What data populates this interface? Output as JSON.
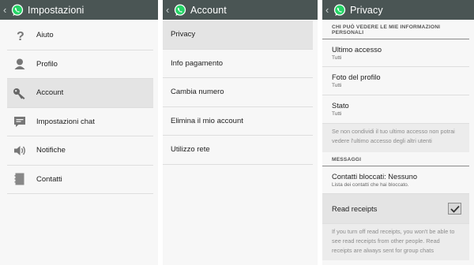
{
  "colors": {
    "appbar": "#4a5554",
    "whatsapp_green": "#25d366",
    "selected_row": "#e4e4e4",
    "divider": "#dedede"
  },
  "panel1": {
    "title": "Impostazioni",
    "items": [
      {
        "label": "Aiuto",
        "icon": "question-icon"
      },
      {
        "label": "Profilo",
        "icon": "profile-icon"
      },
      {
        "label": "Account",
        "icon": "key-icon",
        "selected": true
      },
      {
        "label": "Impostazioni chat",
        "icon": "chat-icon"
      },
      {
        "label": "Notifiche",
        "icon": "speaker-icon"
      },
      {
        "label": "Contatti",
        "icon": "contacts-icon"
      }
    ]
  },
  "panel2": {
    "title": "Account",
    "items": [
      {
        "label": "Privacy",
        "selected": true
      },
      {
        "label": "Info pagamento"
      },
      {
        "label": "Cambia numero"
      },
      {
        "label": "Elimina il mio account"
      },
      {
        "label": "Utilizzo rete"
      }
    ]
  },
  "panel3": {
    "title": "Privacy",
    "section1_header": "CHI PUÒ VEDERE LE MIE INFORMAZIONI PERSONALI",
    "last_seen": {
      "title": "Ultimo accesso",
      "value": "Tutti"
    },
    "profile_photo": {
      "title": "Foto del profilo",
      "value": "Tutti"
    },
    "status": {
      "title": "Stato",
      "value": "Tutti"
    },
    "privacy_note": "Se non condividi il tuo ultimo accesso non potrai vedere l'ultimo accesso degli altri utenti",
    "section2_header": "MESSAGGI",
    "blocked": {
      "title": "Contatti bloccati: Nessuno",
      "subtitle": "Lista dei contatti che hai bloccato."
    },
    "read_receipts": {
      "title": "Read receipts",
      "checked": true
    },
    "read_receipts_note": "If you turn off read receipts, you won't be able to see read receipts from other people. Read receipts are always sent for group chats"
  }
}
